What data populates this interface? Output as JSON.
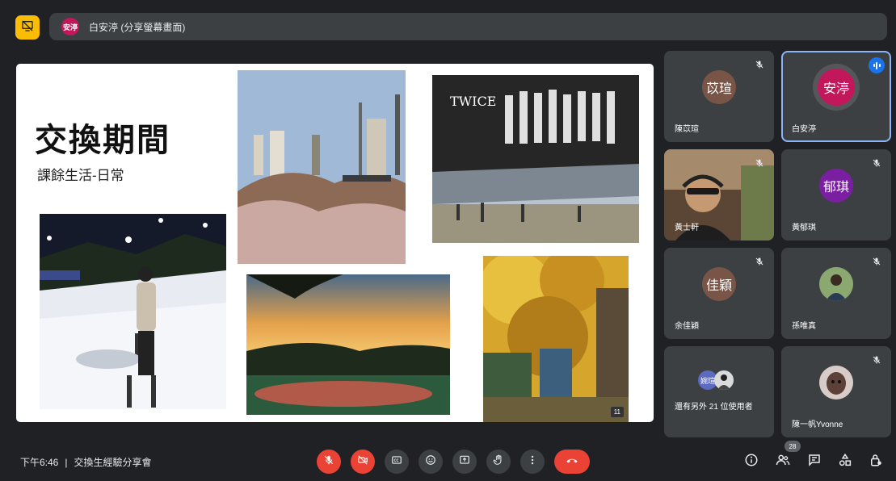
{
  "topbar": {
    "presenter_avatar": "安渟",
    "presentation_title": "白安渟 (分享螢幕畫面)",
    "badge_icon": "screen-share-off-icon"
  },
  "slide": {
    "title": "交換期間",
    "subtitle": "課餘生活-日常",
    "page_number": "11"
  },
  "participants": [
    {
      "avatar": "苡瑄",
      "name": "陳苡瑄",
      "avatar_color": "#795548",
      "muted": true
    },
    {
      "avatar": "安渟",
      "name": "白安渟",
      "avatar_color": "#c2185b",
      "muted": false,
      "speaking": true
    },
    {
      "avatar": "",
      "name": "黃士軒",
      "muted": true,
      "video": true
    },
    {
      "avatar": "郁琪",
      "name": "黃郁琪",
      "avatar_color": "#7b1fa2",
      "muted": true
    },
    {
      "avatar": "佳穎",
      "name": "余佳穎",
      "avatar_color": "#795548",
      "muted": true
    },
    {
      "avatar": "",
      "name": "孫唯真",
      "muted": true,
      "photo": true
    },
    {
      "avatar": "婉瑄",
      "name": "還有另外 21 位使用者",
      "avatar_color": "#5c6bc0",
      "muted": false
    },
    {
      "avatar": "",
      "name": "陳一帆Yvonne",
      "muted": true,
      "photo": true
    }
  ],
  "bottombar": {
    "time": "下午6:46",
    "separator": "|",
    "meeting_name": "交換生經驗分享會",
    "people_count": "28"
  },
  "colors": {
    "bg": "#202124",
    "tile": "#3c4043",
    "danger": "#ea4335",
    "accent": "#8ab4f8",
    "badge": "#fbbc04"
  }
}
